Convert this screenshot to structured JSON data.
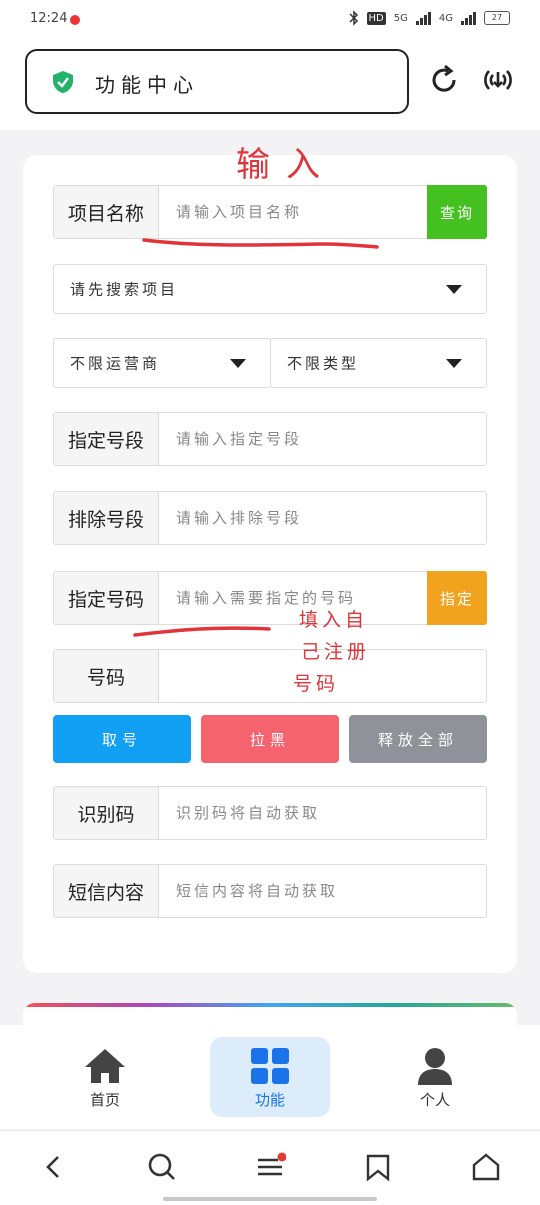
{
  "status": {
    "time": "12:24",
    "net1": "HD",
    "net2": "5G",
    "net3": "4G",
    "battery": "27"
  },
  "header": {
    "title": "功能中心"
  },
  "form": {
    "project": {
      "label": "项目名称",
      "placeholder": "请输入项目名称",
      "button": "查询"
    },
    "project_select": "请先搜索项目",
    "operator_select": "不限运营商",
    "type_select": "不限类型",
    "include_segment": {
      "label": "指定号段",
      "placeholder": "请输入指定号段"
    },
    "exclude_segment": {
      "label": "排除号段",
      "placeholder": "请输入排除号段"
    },
    "specify_number": {
      "label": "指定号码",
      "placeholder": "请输入需要指定的号码",
      "button": "指定"
    },
    "number": {
      "label": "号码",
      "value": ""
    },
    "actions": {
      "get": "取号",
      "blacklist": "拉黑",
      "release_all": "释放全部"
    },
    "code": {
      "label": "识别码",
      "placeholder": "识别码将自动获取"
    },
    "sms": {
      "label": "短信内容",
      "placeholder": "短信内容将自动获取"
    }
  },
  "annotations": {
    "top": "输入",
    "bottom_line1": "填入自",
    "bottom_line2": "己注册",
    "bottom_line3": "号码"
  },
  "colors": {
    "query": "#44c021",
    "specify": "#f1a31e",
    "get": "#12a0f5",
    "blacklist": "#f5646e",
    "release": "#8f9399",
    "annotation": "#e0343a"
  },
  "tabs": [
    {
      "label": "首页",
      "icon": "home-icon"
    },
    {
      "label": "功能",
      "icon": "grid-icon"
    },
    {
      "label": "个人",
      "icon": "person-icon"
    }
  ]
}
